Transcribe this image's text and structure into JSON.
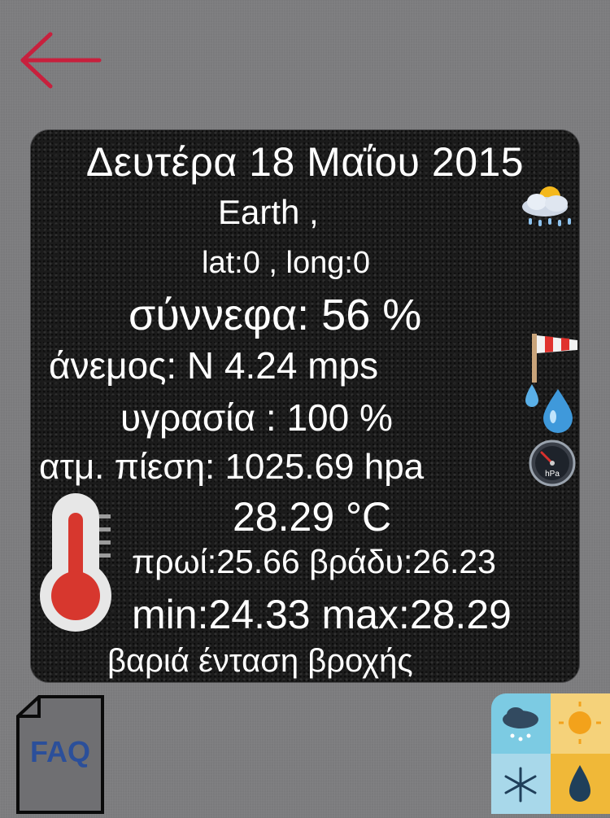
{
  "header": {
    "back_icon": "arrow-left-icon",
    "accent": "#c8203d"
  },
  "weather": {
    "date": "Δευτέρα 18 Μαΐου 2015",
    "location": "Earth ,",
    "coordinates": "lat:0 , long:0",
    "clouds": "σύννεφα:  56 %",
    "wind": "άνεμος:  N   4.24 mps",
    "humidity": "υγρασία  :  100 %",
    "pressure": "ατμ. πίεση:  1025.69 hpa",
    "temperature": "28.29 °C",
    "morning_evening": "πρωί:25.66 βράδυ:26.23",
    "min_max": "min:24.33 max:28.29",
    "description": "βαριά ένταση βροχής",
    "icons": {
      "condition": "partly-cloudy-rain-icon",
      "wind": "windsock-icon",
      "humidity": "water-drop-icon",
      "pressure": "barometer-icon",
      "temperature": "thermometer-icon"
    },
    "pressure_unit_label": "hPa"
  },
  "footer": {
    "faq_label": "FAQ",
    "faq_icon": "faq-document-icon",
    "apps_icon": "weather-apps-grid-icon"
  }
}
